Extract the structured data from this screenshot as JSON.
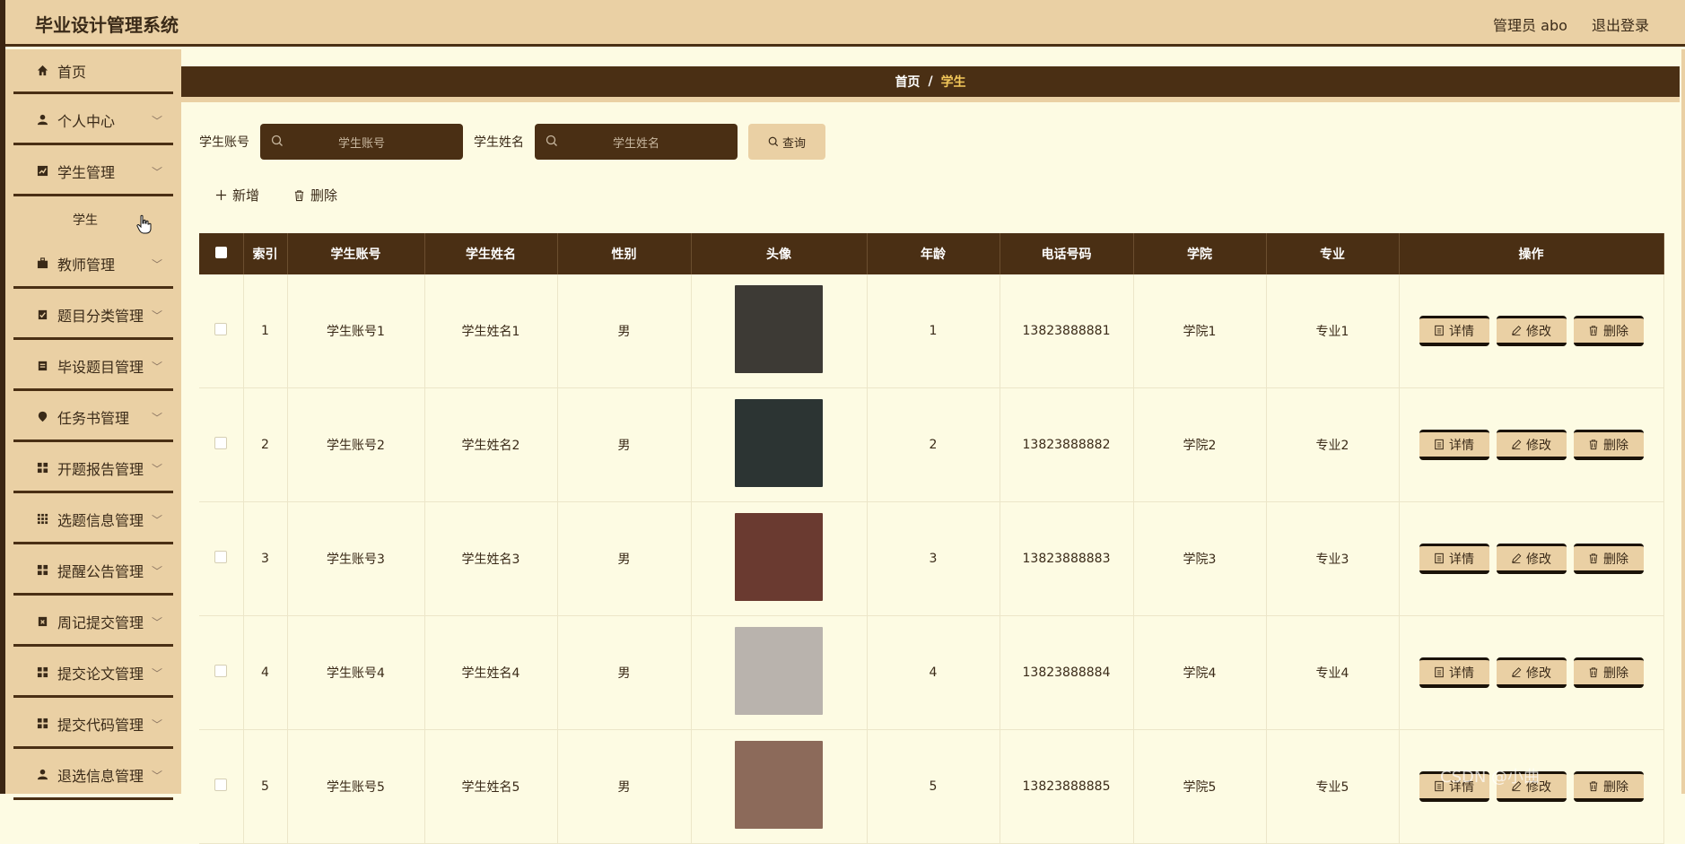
{
  "header": {
    "app_title": "毕业设计管理系统",
    "user_label": "管理员 abo",
    "logout_label": "退出登录"
  },
  "sidebar": {
    "items": [
      {
        "label": "首页",
        "icon": "home-icon"
      },
      {
        "label": "个人中心",
        "icon": "user-icon"
      },
      {
        "label": "学生管理",
        "icon": "chart-icon",
        "sub": [
          "学生"
        ]
      },
      {
        "label": "教师管理",
        "icon": "briefcase-icon"
      },
      {
        "label": "题目分类管理",
        "icon": "clipboard-icon"
      },
      {
        "label": "毕设题目管理",
        "icon": "file-icon"
      },
      {
        "label": "任务书管理",
        "icon": "pin-icon"
      },
      {
        "label": "开题报告管理",
        "icon": "grid-icon"
      },
      {
        "label": "选题信息管理",
        "icon": "grid9-icon"
      },
      {
        "label": "提醒公告管理",
        "icon": "grid-icon"
      },
      {
        "label": "周记提交管理",
        "icon": "calendar-icon"
      },
      {
        "label": "提交论文管理",
        "icon": "grid-icon"
      },
      {
        "label": "提交代码管理",
        "icon": "grid-icon"
      },
      {
        "label": "退选信息管理",
        "icon": "user-icon"
      }
    ]
  },
  "breadcrumb": {
    "home": "首页",
    "separator": "/",
    "current": "学生"
  },
  "search": {
    "account_label": "学生账号",
    "account_placeholder": "学生账号",
    "name_label": "学生姓名",
    "name_placeholder": "学生姓名",
    "query_label": "查询"
  },
  "actions": {
    "add_label": "新增",
    "delete_label": "删除"
  },
  "table": {
    "columns": [
      "索引",
      "学生账号",
      "学生姓名",
      "性别",
      "头像",
      "年龄",
      "电话号码",
      "学院",
      "专业",
      "操作"
    ],
    "op_labels": {
      "detail": "详情",
      "edit": "修改",
      "delete": "删除"
    },
    "rows": [
      {
        "index": "1",
        "account": "学生账号1",
        "name": "学生姓名1",
        "gender": "男",
        "age": "1",
        "phone": "13823888881",
        "college": "学院1",
        "major": "专业1",
        "avatar_color": "#3d3a35"
      },
      {
        "index": "2",
        "account": "学生账号2",
        "name": "学生姓名2",
        "gender": "男",
        "age": "2",
        "phone": "13823888882",
        "college": "学院2",
        "major": "专业2",
        "avatar_color": "#2c3433"
      },
      {
        "index": "3",
        "account": "学生账号3",
        "name": "学生姓名3",
        "gender": "男",
        "age": "3",
        "phone": "13823888883",
        "college": "学院3",
        "major": "专业3",
        "avatar_color": "#6a3a30"
      },
      {
        "index": "4",
        "account": "学生账号4",
        "name": "学生姓名4",
        "gender": "男",
        "age": "4",
        "phone": "13823888884",
        "college": "学院4",
        "major": "专业4",
        "avatar_color": "#b9b3ad"
      },
      {
        "index": "5",
        "account": "学生账号5",
        "name": "学生姓名5",
        "gender": "男",
        "age": "5",
        "phone": "13823888885",
        "college": "学院5",
        "major": "专业5",
        "avatar_color": "#8c6a5a"
      }
    ]
  },
  "watermark": "CSDN @小曲"
}
